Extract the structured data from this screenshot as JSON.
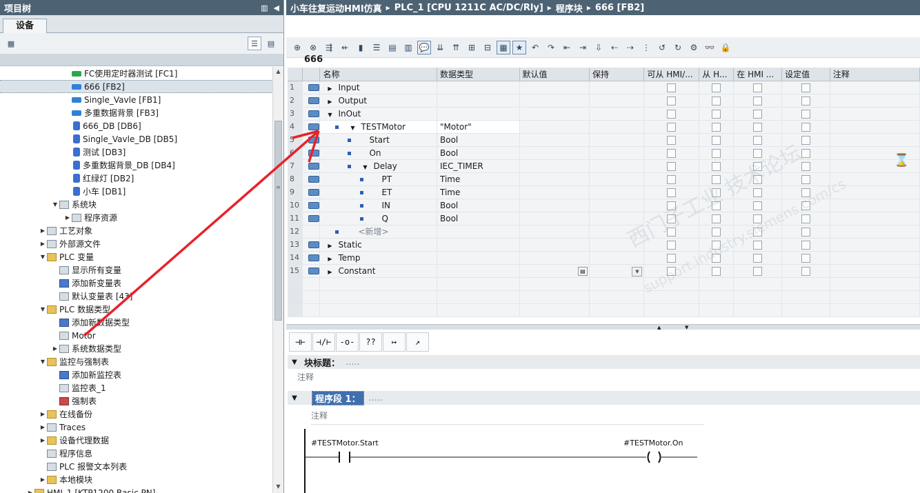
{
  "left_panel": {
    "title": "项目树",
    "tab": "设备",
    "tree": [
      {
        "indent": 3,
        "icon": "fc",
        "label": "FC使用定时器测试 [FC1]"
      },
      {
        "indent": 3,
        "icon": "fb",
        "label": "666 [FB2]",
        "selected": true
      },
      {
        "indent": 3,
        "icon": "fb",
        "label": "Single_Vavle [FB1]"
      },
      {
        "indent": 3,
        "icon": "fb",
        "label": "多重数据背景 [FB3]"
      },
      {
        "indent": 3,
        "icon": "db",
        "label": "666_DB [DB6]"
      },
      {
        "indent": 3,
        "icon": "db",
        "label": "Single_Vavle_DB [DB5]"
      },
      {
        "indent": 3,
        "icon": "db",
        "label": "测试 [DB3]"
      },
      {
        "indent": 3,
        "icon": "db",
        "label": "多重数据背景_DB [DB4]"
      },
      {
        "indent": 3,
        "icon": "db",
        "label": "红绿灯 [DB2]"
      },
      {
        "indent": 3,
        "icon": "db",
        "label": "小车 [DB1]"
      },
      {
        "indent": 2,
        "tri": "▼",
        "icon": "sheet",
        "label": "系统块"
      },
      {
        "indent": 3,
        "tri": "▶",
        "icon": "sheet",
        "label": "程序资源"
      },
      {
        "indent": 1,
        "tri": "▶",
        "icon": "sheet",
        "label": "工艺对象"
      },
      {
        "indent": 1,
        "tri": "▶",
        "icon": "sheet",
        "label": "外部源文件"
      },
      {
        "indent": 1,
        "tri": "▼",
        "icon": "folder",
        "label": "PLC 变量"
      },
      {
        "indent": 2,
        "icon": "sheet",
        "label": "显示所有变量"
      },
      {
        "indent": 2,
        "icon": "add",
        "label": "添加新变量表"
      },
      {
        "indent": 2,
        "icon": "sheet",
        "label": "默认变量表 [43]"
      },
      {
        "indent": 1,
        "tri": "▼",
        "icon": "folder",
        "label": "PLC 数据类型"
      },
      {
        "indent": 2,
        "icon": "add",
        "label": "添加新数据类型"
      },
      {
        "indent": 2,
        "icon": "sheet",
        "label": "Motor"
      },
      {
        "indent": 2,
        "tri": "▶",
        "icon": "sheet",
        "label": "系统数据类型"
      },
      {
        "indent": 1,
        "tri": "▼",
        "icon": "folder",
        "label": "监控与强制表"
      },
      {
        "indent": 2,
        "icon": "add",
        "label": "添加新监控表"
      },
      {
        "indent": 2,
        "icon": "sheet",
        "label": "监控表_1"
      },
      {
        "indent": 2,
        "icon": "red",
        "label": "强制表"
      },
      {
        "indent": 1,
        "tri": "▶",
        "icon": "folder",
        "label": "在线备份"
      },
      {
        "indent": 1,
        "tri": "▶",
        "icon": "sheet",
        "label": "Traces"
      },
      {
        "indent": 1,
        "tri": "▶",
        "icon": "folder",
        "label": "设备代理数据"
      },
      {
        "indent": 1,
        "icon": "sheet",
        "label": "程序信息"
      },
      {
        "indent": 1,
        "icon": "sheet",
        "label": "PLC 报警文本列表"
      },
      {
        "indent": 1,
        "tri": "▶",
        "icon": "folder",
        "label": "本地模块"
      },
      {
        "indent": 0,
        "tri": "▶",
        "icon": "folder",
        "label": "HMI_1 [KTP1200 Basic PN]"
      }
    ]
  },
  "editor": {
    "breadcrumb": [
      "小车往复运动HMI仿真",
      "PLC_1 [CPU 1211C AC/DC/Rly]",
      "程序块",
      "666 [FB2]"
    ],
    "block_name": "666",
    "columns": [
      "",
      "",
      "名称",
      "数据类型",
      "默认值",
      "保持",
      "可从 HMI/...",
      "从 H...",
      "在 HMI ...",
      "设定值",
      "注释"
    ],
    "rows": [
      {
        "n": "1",
        "lvl": 0,
        "tri": "▶",
        "name": "Input",
        "type": "",
        "cbs": true
      },
      {
        "n": "2",
        "lvl": 0,
        "tri": "▶",
        "name": "Output",
        "type": "",
        "cbs": true
      },
      {
        "n": "3",
        "lvl": 0,
        "tri": "▼",
        "name": "InOut",
        "type": "",
        "cbs": true
      },
      {
        "n": "4",
        "lvl": 1,
        "tri": "▼",
        "name": "TESTMotor",
        "type": "\"Motor\"",
        "cbs": true,
        "sel": true
      },
      {
        "n": "5",
        "lvl": 2,
        "tri": "",
        "name": "Start",
        "type": "Bool",
        "cbs": true
      },
      {
        "n": "6",
        "lvl": 2,
        "tri": "",
        "name": "On",
        "type": "Bool",
        "cbs": true
      },
      {
        "n": "7",
        "lvl": 2,
        "tri": "▼",
        "name": "Delay",
        "type": "IEC_TIMER",
        "cbs": true
      },
      {
        "n": "8",
        "lvl": 3,
        "tri": "",
        "name": "PT",
        "type": "Time",
        "cbs": true
      },
      {
        "n": "9",
        "lvl": 3,
        "tri": "",
        "name": "ET",
        "type": "Time",
        "cbs": true
      },
      {
        "n": "10",
        "lvl": 3,
        "tri": "",
        "name": "IN",
        "type": "Bool",
        "cbs": true
      },
      {
        "n": "11",
        "lvl": 3,
        "tri": "",
        "name": "Q",
        "type": "Bool",
        "cbs": true
      },
      {
        "n": "12",
        "lvl": 1,
        "tri": "",
        "name": "<新增>",
        "type": "",
        "cbs": true,
        "new": true
      },
      {
        "n": "13",
        "lvl": 0,
        "tri": "▶",
        "name": "Static",
        "type": "",
        "cbs": true
      },
      {
        "n": "14",
        "lvl": 0,
        "tri": "▶",
        "name": "Temp",
        "type": "",
        "cbs": true
      },
      {
        "n": "15",
        "lvl": 0,
        "tri": "▶",
        "name": "Constant",
        "type": "",
        "cbs": true,
        "last": true
      }
    ],
    "ladder_toolbar": [
      "⊣⊢",
      "⊣/⊢",
      "-o-",
      "??",
      "↦",
      "↗"
    ],
    "block_title_label": "块标题：",
    "block_title_dots": ".....",
    "comment_label": "注释",
    "network_label": "程序段 1：",
    "network_dots": ".....",
    "network_comment": "注释",
    "contact_label": "#TESTMotor.Start",
    "coil_label": "#TESTMotor.On"
  },
  "watermark": {
    "line1": "西门子工业  技术论坛",
    "line2": "support.industry.siemens.com/cs"
  }
}
